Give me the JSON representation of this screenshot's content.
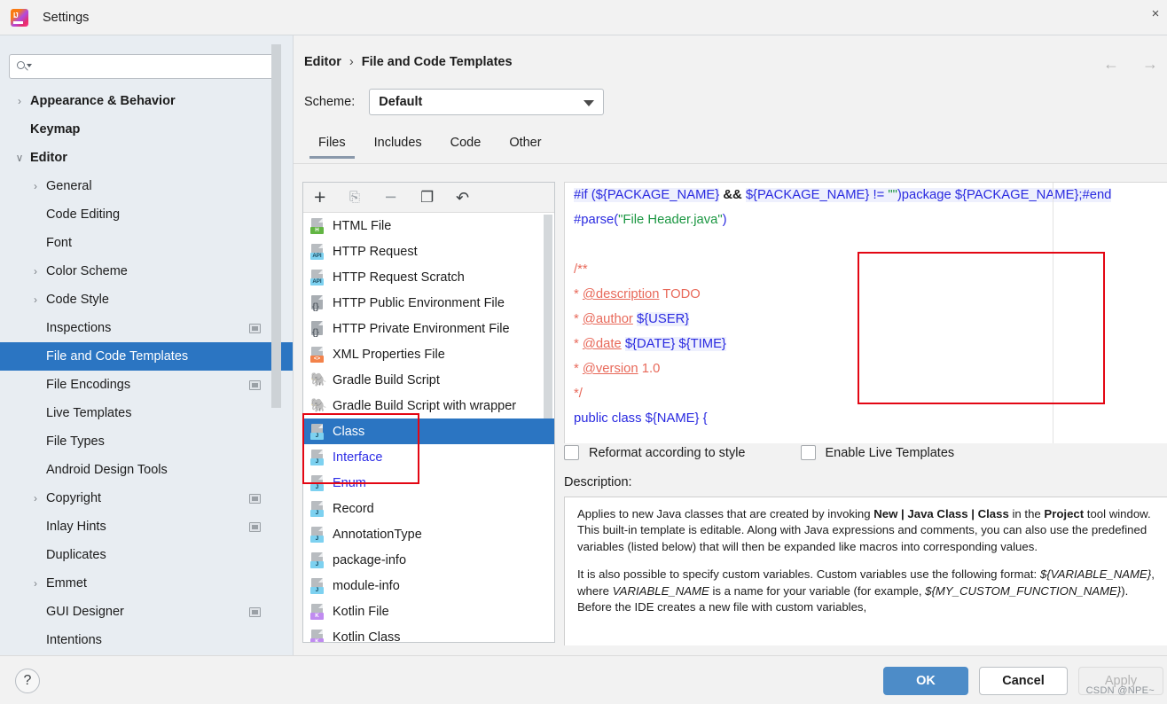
{
  "window": {
    "title": "Settings",
    "app_icon": "intellij-idea-icon",
    "close_label": "×"
  },
  "sidebar": {
    "search": {
      "placeholder": "",
      "value": "",
      "icon": "search-icon"
    },
    "items": [
      {
        "label": "Appearance & Behavior",
        "depth": 0,
        "arrow": "›",
        "badge": false
      },
      {
        "label": "Keymap",
        "depth": 0,
        "arrow": "",
        "badge": false
      },
      {
        "label": "Editor",
        "depth": 0,
        "arrow": "∨",
        "badge": false
      },
      {
        "label": "General",
        "depth": 1,
        "arrow": "›",
        "badge": false
      },
      {
        "label": "Code Editing",
        "depth": 1,
        "arrow": "",
        "badge": false
      },
      {
        "label": "Font",
        "depth": 1,
        "arrow": "",
        "badge": false
      },
      {
        "label": "Color Scheme",
        "depth": 1,
        "arrow": "›",
        "badge": false
      },
      {
        "label": "Code Style",
        "depth": 1,
        "arrow": "›",
        "badge": false
      },
      {
        "label": "Inspections",
        "depth": 1,
        "arrow": "",
        "badge": true
      },
      {
        "label": "File and Code Templates",
        "depth": 1,
        "arrow": "",
        "badge": false,
        "selected": true
      },
      {
        "label": "File Encodings",
        "depth": 1,
        "arrow": "",
        "badge": true
      },
      {
        "label": "Live Templates",
        "depth": 1,
        "arrow": "",
        "badge": false
      },
      {
        "label": "File Types",
        "depth": 1,
        "arrow": "",
        "badge": false
      },
      {
        "label": "Android Design Tools",
        "depth": 1,
        "arrow": "",
        "badge": false
      },
      {
        "label": "Copyright",
        "depth": 1,
        "arrow": "›",
        "badge": true
      },
      {
        "label": "Inlay Hints",
        "depth": 1,
        "arrow": "",
        "badge": true
      },
      {
        "label": "Duplicates",
        "depth": 1,
        "arrow": "",
        "badge": false
      },
      {
        "label": "Emmet",
        "depth": 1,
        "arrow": "›",
        "badge": false
      },
      {
        "label": "GUI Designer",
        "depth": 1,
        "arrow": "",
        "badge": true
      },
      {
        "label": "Intentions",
        "depth": 1,
        "arrow": "",
        "badge": false
      }
    ]
  },
  "panel": {
    "breadcrumb": {
      "parent": "Editor",
      "separator": "›",
      "current": "File and Code Templates"
    },
    "nav": {
      "back": "←",
      "forward": "→"
    },
    "scheme": {
      "label": "Scheme:",
      "value": "Default"
    },
    "tabs": [
      {
        "label": "Files",
        "active": true
      },
      {
        "label": "Includes",
        "active": false
      },
      {
        "label": "Code",
        "active": false
      },
      {
        "label": "Other",
        "active": false
      }
    ],
    "list_toolbar": [
      {
        "name": "add-template-button",
        "glyph": "+",
        "style": "tb-plus"
      },
      {
        "name": "new-from-file-button",
        "glyph": "⎘",
        "style": "tb-newfile"
      },
      {
        "name": "remove-template-button",
        "glyph": "−",
        "style": "tb-minus"
      },
      {
        "name": "copy-template-button",
        "glyph": "❐",
        "style": "tb-copy"
      },
      {
        "name": "reset-template-button",
        "glyph": "↶",
        "style": "tb-undo"
      }
    ],
    "templates": [
      {
        "label": "HTML File",
        "icon": "html-file-icon",
        "tag": "H",
        "tagclass": "green"
      },
      {
        "label": "HTTP Request",
        "icon": "http-request-icon",
        "tag": "API",
        "tagclass": "api"
      },
      {
        "label": "HTTP Request Scratch",
        "icon": "http-request-icon",
        "tag": "API",
        "tagclass": "api"
      },
      {
        "label": "HTTP Public Environment File",
        "icon": "env-file-icon",
        "tag": "",
        "tagclass": "env"
      },
      {
        "label": "HTTP Private Environment File",
        "icon": "env-file-icon",
        "tag": "",
        "tagclass": "env"
      },
      {
        "label": "XML Properties File",
        "icon": "xml-file-icon",
        "tag": "<>",
        "tagclass": "orange"
      },
      {
        "label": "Gradle Build Script",
        "icon": "gradle-icon",
        "tag": "",
        "tagclass": "gradle"
      },
      {
        "label": "Gradle Build Script with wrapper",
        "icon": "gradle-icon",
        "tag": "",
        "tagclass": "gradle"
      },
      {
        "label": "Class",
        "icon": "java-class-icon",
        "tag": "J",
        "tagclass": "java",
        "selected": true
      },
      {
        "label": "Interface",
        "icon": "java-class-icon",
        "tag": "J",
        "tagclass": "java",
        "blue": true
      },
      {
        "label": "Enum",
        "icon": "java-class-icon",
        "tag": "J",
        "tagclass": "java",
        "blue": true
      },
      {
        "label": "Record",
        "icon": "java-class-icon",
        "tag": "J",
        "tagclass": "java"
      },
      {
        "label": "AnnotationType",
        "icon": "java-class-icon",
        "tag": "J",
        "tagclass": "java"
      },
      {
        "label": "package-info",
        "icon": "java-class-icon",
        "tag": "J",
        "tagclass": "java"
      },
      {
        "label": "module-info",
        "icon": "java-class-icon",
        "tag": "J",
        "tagclass": "java"
      },
      {
        "label": "Kotlin File",
        "icon": "kotlin-file-icon",
        "tag": "K",
        "tagclass": "kt"
      },
      {
        "label": "Kotlin Class",
        "icon": "kotlin-file-icon",
        "tag": "K",
        "tagclass": "kt"
      }
    ],
    "editor": {
      "line1": {
        "a": "#if (${PACKAGE_NAME}",
        "b": " && ",
        "c": "${PACKAGE_NAME} != ",
        "d": "\"\"",
        "e": ")package ${PACKAGE_NAME};#end"
      },
      "line2": {
        "a": "#parse(",
        "b": "\"File Header.java\"",
        "c": ")"
      },
      "javadoc": [
        "/**",
        "* @description TODO",
        "* @author ${USER}",
        "* @date ${DATE} ${TIME}",
        "* @version 1.0",
        "*/"
      ],
      "javadoc_tags": [
        "",
        "@description",
        "@author",
        "@date",
        "@version",
        ""
      ],
      "javadoc_values": [
        "",
        "TODO",
        "${USER}",
        "${DATE} ${TIME}",
        "1.0",
        ""
      ],
      "line_last": "public class ${NAME} {"
    },
    "checkboxes": [
      {
        "label": "Reformat according to style",
        "checked": false
      },
      {
        "label": "Enable Live Templates",
        "checked": false
      }
    ],
    "description_label": "Description:",
    "description": {
      "p1_pre": "Applies to new Java classes that are created by invoking ",
      "p1_bold": "New | Java Class | Class",
      "p1_mid": " in the ",
      "p1_bold2": "Project",
      "p1_post": " tool window.",
      "p2": "This built-in template is editable. Along with Java expressions and comments, you can also use the predefined variables (listed below) that will then be expanded like macros into corresponding values.",
      "p3_pre": "It is also possible to specify custom variables. Custom variables use the following format: ",
      "p3_i1": "${VARIABLE_NAME}",
      "p3_mid": ", where ",
      "p3_i2": "VARIABLE_NAME",
      "p3_mid2": " is a name for your variable (for example, ",
      "p3_i3": "${MY_CUSTOM_FUNCTION_NAME}",
      "p3_post": "). Before the IDE creates a new file with custom variables,"
    }
  },
  "footer": {
    "help": "?",
    "ok": "OK",
    "cancel": "Cancel",
    "apply": "Apply",
    "watermark": "CSDN @NPE~"
  },
  "colors": {
    "selection_blue": "#2b75c2",
    "sidebar_bg": "#e8edf2",
    "panel_bg": "#f2f2f2",
    "annotation_red": "#e30613",
    "ok_button": "#4d8cc8"
  }
}
